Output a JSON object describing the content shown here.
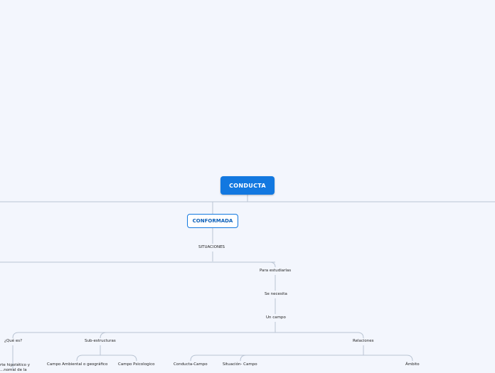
{
  "map": {
    "root": "CONDUCTA",
    "main": "CONFORMADA",
    "situaciones": "SITUACIONES",
    "para_estudiarlas": "Para estudiarlas",
    "se_necesita": "Se necesita",
    "un_campo": "Un campo",
    "que_es": "¿Qué es?",
    "sub_estructuras": "Sub-estructuras",
    "relaciones": "Relaciones",
    "constructo": "rte hipotético y\n...nomal de la",
    "campo_ambiental": "Campo Ambiental o geográfico",
    "campo_psicologico": "Campo Psicologico",
    "conducta_campo": "Conducta-Campo",
    "situacion_campo": "Situación- Campo",
    "ambito": "Ámbito"
  },
  "colors": {
    "accent": "#1278e0",
    "line": "#b9c4d3",
    "background": "#f3f6fd"
  }
}
